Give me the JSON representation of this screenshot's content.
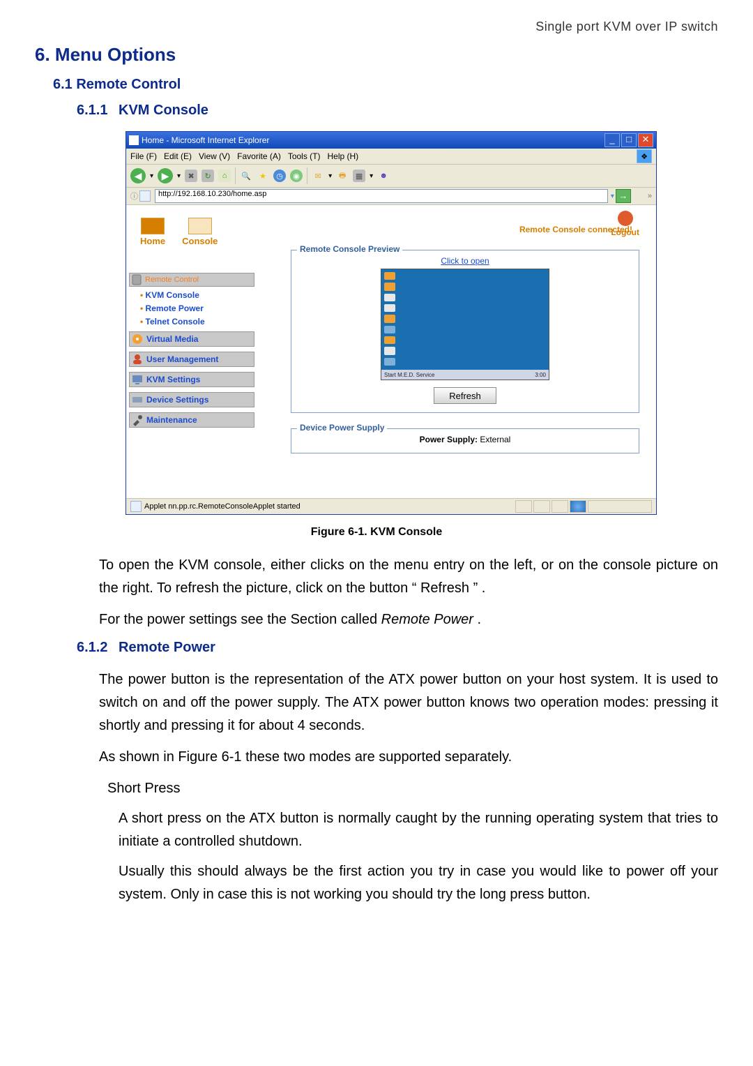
{
  "page_header_right": "Single port KVM over IP switch",
  "h1": "6.  Menu Options",
  "h2": "6.1 Remote Control",
  "h3_1_num": "6.1.1",
  "h3_1": "KVM Console",
  "fig_caption": "Figure 6-1. KVM Console",
  "para_1": "To open the KVM console, either clicks on the menu entry on the left, or on the console picture on the right. To refresh the picture, click on the button “ Refresh ” .",
  "para_2": "For the power settings see the Section called Remote Power .",
  "h3_2_num": "6.1.2",
  "h3_2": "Remote Power",
  "para_3": "The power button is the representation of the ATX power button on your host system. It is used to switch on and off the power supply. The ATX power button knows two operation modes: pressing it shortly and pressing it for about 4 seconds.",
  "para_4": "As shown in Figure 6-1 these two modes are supported separately.",
  "sub_h": "Short Press",
  "para_5": "A short press on the ATX button is normally caught by the running operating system that tries to initiate a controlled shutdown.",
  "para_6": "Usually this should always be the first action you try in case you would like to power off your system. Only in case this is not working you should try the long press button.",
  "window": {
    "title": "Home - Microsoft Internet Explorer",
    "menus": [
      "File (F)",
      "Edit (E)",
      "View (V)",
      "Favorite (A)",
      "Tools (T)",
      "Help (H)"
    ],
    "address": "http://192.168.10.230/home.asp",
    "go_chevron": "»"
  },
  "app": {
    "home": "Home",
    "console": "Console",
    "status": "Remote Console connected!",
    "logout": "Logout",
    "side_head": "Remote Control",
    "links": [
      "KVM Console",
      "Remote Power",
      "Telnet Console"
    ],
    "buttons": [
      "Virtual Media",
      "User Management",
      "KVM Settings",
      "Device Settings",
      "Maintenance"
    ],
    "fs1": "Remote Console Preview",
    "open": "Click to open",
    "pv_bar_left": "Start  M.E.D. Service",
    "pv_bar_right": "3:00",
    "refresh": "Refresh",
    "fs2": "Device Power Supply",
    "ps_label": "Power Supply:",
    "ps_val": " External",
    "statusbar": "Applet nn.pp.rc.RemoteConsoleApplet started"
  }
}
